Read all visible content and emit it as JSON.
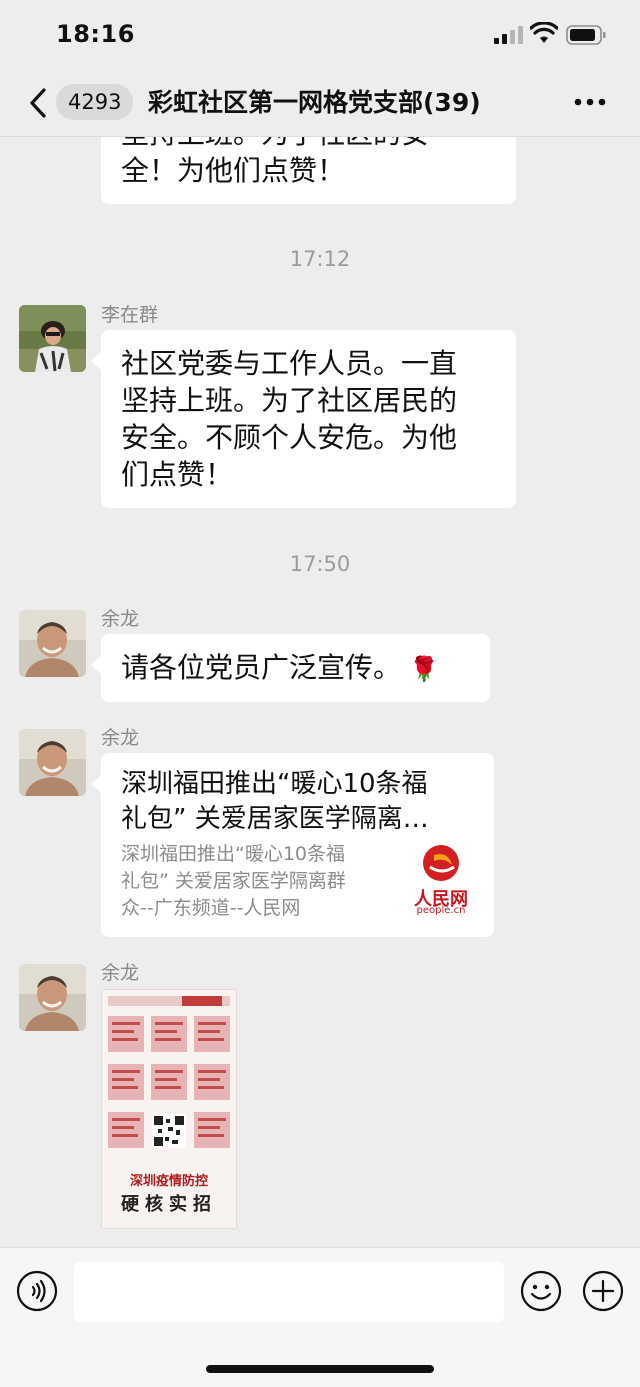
{
  "status_bar": {
    "time": "18:16"
  },
  "nav": {
    "unread_count": "4293",
    "title": "彩虹社区第一网格党支部(39)"
  },
  "input": {
    "placeholder": ""
  },
  "messages": [
    {
      "type": "text",
      "text_lines": [
        "坚持上班。为了社区的安",
        "全！为他们点赞！"
      ]
    },
    {
      "type": "time",
      "text": "17:12"
    },
    {
      "type": "text",
      "sender": "李在群",
      "avatar": "woman-in-garden",
      "text_lines": [
        "社区党委与工作人员。一直",
        "坚持上班。为了社区居民的",
        "安全。不顾个人安危。为他",
        "们点赞！"
      ]
    },
    {
      "type": "time",
      "text": "17:50"
    },
    {
      "type": "text",
      "sender": "余龙",
      "avatar": "smiling-man",
      "text": "请各位党员广泛宣传。",
      "emoji": "🌹"
    },
    {
      "type": "link",
      "sender": "余龙",
      "avatar": "smiling-man",
      "title_lines": [
        "深圳福田推出“暖心10条福",
        "礼包” 关爱居家医学隔离…"
      ],
      "desc_lines": [
        "深圳福田推出“暖心10条福",
        "礼包” 关爱居家医学隔离群",
        "众--广东频道--人民网"
      ],
      "logo_text": "人民网",
      "logo_sub": "people.cn"
    },
    {
      "type": "image",
      "sender": "余龙",
      "avatar": "smiling-man",
      "poster_caption": "深圳疫情防控",
      "poster_caption2": "硬核实招"
    }
  ],
  "colors": {
    "accent_red": "#c8161d",
    "bubble": "#ffffff",
    "background": "#ededed"
  }
}
